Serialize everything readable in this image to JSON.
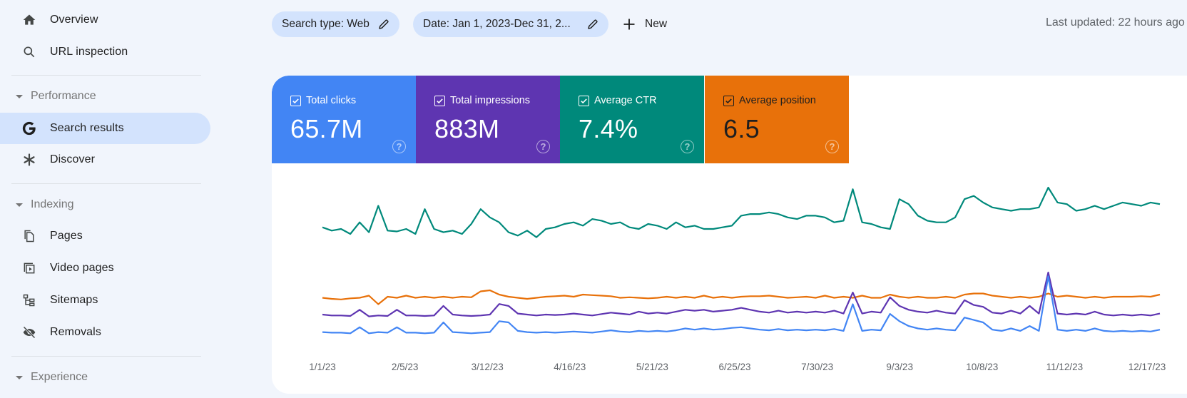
{
  "sidebar": {
    "top_items": [
      {
        "label": "Overview",
        "icon": "home-icon"
      },
      {
        "label": "URL inspection",
        "icon": "search-icon"
      }
    ],
    "sections": [
      {
        "label": "Performance",
        "items": [
          {
            "label": "Search results",
            "icon": "google-g-icon",
            "active": true
          },
          {
            "label": "Discover",
            "icon": "asterisk-icon",
            "active": false
          }
        ]
      },
      {
        "label": "Indexing",
        "items": [
          {
            "label": "Pages",
            "icon": "pages-icon"
          },
          {
            "label": "Video pages",
            "icon": "video-pages-icon"
          },
          {
            "label": "Sitemaps",
            "icon": "sitemap-icon"
          },
          {
            "label": "Removals",
            "icon": "eye-off-icon"
          }
        ]
      },
      {
        "label": "Experience",
        "items": []
      }
    ]
  },
  "filters": {
    "search_type": "Search type: Web",
    "date": "Date: Jan 1, 2023-Dec 31, 2...",
    "new_label": "New"
  },
  "last_updated": "Last updated: 22 hours ago",
  "metrics": [
    {
      "label": "Total clicks",
      "value": "65.7M",
      "color": "#4285f4",
      "checked": true
    },
    {
      "label": "Total impressions",
      "value": "883M",
      "color": "#5e35b1",
      "checked": true
    },
    {
      "label": "Average CTR",
      "value": "7.4%",
      "color": "#00897b",
      "checked": true
    },
    {
      "label": "Average position",
      "value": "6.5",
      "color": "#e8710a",
      "checked": true
    }
  ],
  "help_glyph": "?",
  "chart_data": {
    "type": "line",
    "title": "",
    "xlabel": "",
    "ylabel": "",
    "x_tick_labels": [
      "1/1/23",
      "2/5/23",
      "3/12/23",
      "4/16/23",
      "5/21/23",
      "6/25/23",
      "7/30/23",
      "9/3/23",
      "10/8/23",
      "11/12/23",
      "12/17/23"
    ],
    "x_range": [
      "2023-01-01",
      "2023-12-31"
    ],
    "y_axis_visible": false,
    "grid": false,
    "note": "Each series is independently normalized (0-100 relative scale); values approximated weekly from the plotted lines.",
    "series": [
      {
        "name": "Average CTR",
        "color": "#00897b",
        "values": [
          52,
          48,
          50,
          44,
          58,
          46,
          78,
          48,
          47,
          50,
          44,
          74,
          50,
          46,
          48,
          44,
          56,
          74,
          64,
          58,
          46,
          42,
          48,
          40,
          50,
          52,
          56,
          58,
          54,
          62,
          60,
          56,
          58,
          52,
          50,
          56,
          54,
          50,
          58,
          52,
          54,
          50,
          50,
          52,
          54,
          66,
          68,
          68,
          70,
          68,
          64,
          62,
          66,
          66,
          64,
          58,
          60,
          98,
          58,
          56,
          52,
          50,
          86,
          80,
          66,
          60,
          58,
          58,
          64,
          86,
          90,
          82,
          76,
          74,
          72,
          74,
          74,
          76,
          100,
          82,
          80,
          72,
          74,
          78,
          74,
          78,
          82,
          80,
          78,
          82,
          80
        ]
      },
      {
        "name": "Average position",
        "color": "#e8710a",
        "values": [
          22,
          20,
          19,
          21,
          22,
          26,
          10,
          24,
          22,
          26,
          22,
          24,
          22,
          24,
          22,
          24,
          23,
          34,
          36,
          28,
          24,
          22,
          20,
          22,
          24,
          25,
          26,
          24,
          28,
          27,
          26,
          25,
          22,
          23,
          22,
          21,
          22,
          24,
          22,
          24,
          22,
          26,
          22,
          24,
          22,
          24,
          25,
          25,
          26,
          24,
          22,
          23,
          24,
          22,
          26,
          22,
          24,
          22,
          26,
          22,
          22,
          28,
          24,
          22,
          24,
          22,
          22,
          24,
          22,
          28,
          30,
          30,
          26,
          24,
          22,
          24,
          22,
          24,
          30,
          24,
          26,
          24,
          22,
          24,
          22,
          24,
          24,
          24,
          25,
          24,
          28
        ]
      },
      {
        "name": "Total impressions",
        "color": "#5e35b1",
        "values": [
          12,
          10,
          10,
          9,
          22,
          8,
          10,
          9,
          22,
          10,
          10,
          9,
          10,
          30,
          12,
          10,
          9,
          10,
          12,
          34,
          30,
          14,
          12,
          10,
          12,
          11,
          12,
          14,
          12,
          10,
          13,
          16,
          14,
          12,
          18,
          14,
          16,
          14,
          18,
          22,
          20,
          22,
          18,
          20,
          22,
          26,
          22,
          18,
          16,
          20,
          16,
          18,
          16,
          18,
          16,
          20,
          14,
          58,
          14,
          18,
          16,
          48,
          30,
          22,
          18,
          16,
          20,
          16,
          14,
          42,
          32,
          28,
          16,
          14,
          20,
          14,
          30,
          14,
          100,
          14,
          12,
          14,
          12,
          18,
          12,
          10,
          12,
          10,
          12,
          10,
          14
        ]
      },
      {
        "name": "Total clicks",
        "color": "#4285f4",
        "values": [
          4,
          3,
          3,
          2,
          12,
          2,
          4,
          3,
          12,
          3,
          3,
          2,
          3,
          20,
          4,
          3,
          2,
          3,
          4,
          22,
          20,
          6,
          4,
          3,
          4,
          3,
          4,
          5,
          4,
          3,
          5,
          7,
          5,
          4,
          6,
          5,
          6,
          5,
          7,
          10,
          8,
          10,
          8,
          9,
          11,
          12,
          10,
          8,
          7,
          9,
          7,
          8,
          7,
          8,
          7,
          9,
          6,
          50,
          6,
          8,
          7,
          34,
          22,
          14,
          10,
          8,
          10,
          8,
          7,
          28,
          24,
          20,
          8,
          6,
          10,
          6,
          14,
          6,
          96,
          8,
          6,
          8,
          6,
          10,
          6,
          5,
          6,
          5,
          6,
          5,
          8
        ]
      }
    ]
  }
}
